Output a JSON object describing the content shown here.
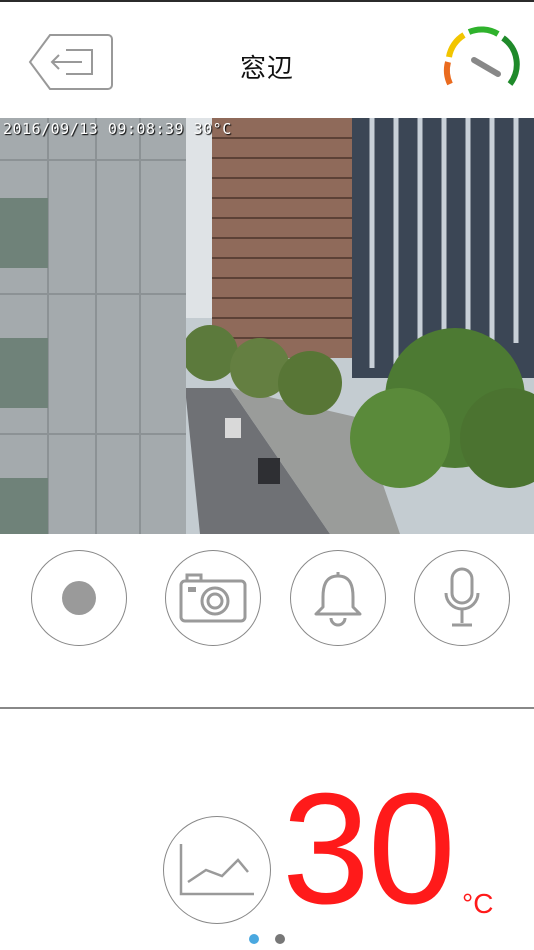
{
  "header": {
    "title": "窓辺",
    "back_icon": "back-arrow-icon",
    "speed_icon": "speedometer-icon",
    "gauge_colors": [
      "#ea6b1f",
      "#f2c500",
      "#2fb22c",
      "#1f8a2a"
    ]
  },
  "video": {
    "overlay_text": "2016/09/13 09:08:39 30°C"
  },
  "controls": [
    {
      "name": "record",
      "icon": "record-icon"
    },
    {
      "name": "snapshot",
      "icon": "camera-icon"
    },
    {
      "name": "alarm",
      "icon": "bell-icon"
    },
    {
      "name": "microphone",
      "icon": "microphone-icon"
    }
  ],
  "temperature": {
    "value": "30",
    "unit": "°C",
    "color": "#ff1a1a",
    "graph_icon": "line-chart-icon"
  },
  "pager": {
    "page_count": 2,
    "active_index": 0,
    "active_color": "#4aa8e0",
    "inactive_color": "#777777"
  }
}
